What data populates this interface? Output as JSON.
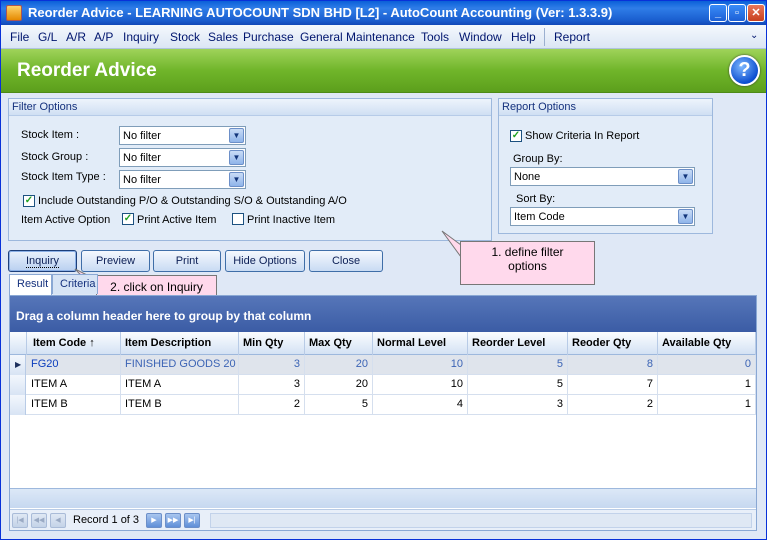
{
  "window": {
    "title": "Reorder Advice - LEARNING AUTOCOUNT SDN BHD [L2] - AutoCount Accounting (Ver: 1.3.3.9)"
  },
  "window_controls": {
    "minimize": "_",
    "restore": "▫",
    "close": "✕"
  },
  "menu": [
    "File",
    "G/L",
    "A/R",
    "A/P",
    "Inquiry",
    "Stock",
    "Sales",
    "Purchase",
    "General Maintenance",
    "Tools",
    "Window",
    "Help",
    "Report"
  ],
  "menu_chevron": "⌄",
  "header": {
    "title": "Reorder Advice",
    "help_glyph": "?"
  },
  "filter": {
    "title": "Filter Options",
    "stock_item_label": "Stock Item :",
    "stock_item_value": "No filter",
    "stock_group_label": "Stock Group :",
    "stock_group_value": "No filter",
    "stock_item_type_label": "Stock Item Type :",
    "stock_item_type_value": "No filter",
    "include_outstanding_label": "Include Outstanding P/O & Outstanding S/O & Outstanding A/O",
    "include_outstanding_checked": true,
    "item_active_label": "Item Active Option",
    "print_active_label": "Print Active Item",
    "print_active_checked": true,
    "print_inactive_label": "Print Inactive Item",
    "print_inactive_checked": false
  },
  "report_options": {
    "title": "Report Options",
    "show_criteria_label": "Show Criteria In Report",
    "show_criteria_checked": true,
    "group_by_label": "Group By:",
    "group_by_value": "None",
    "sort_by_label": "Sort By:",
    "sort_by_value": "Item Code"
  },
  "buttons": {
    "inquiry": "Inquiry",
    "preview": "Preview",
    "print": "Print",
    "hide_options": "Hide Options",
    "close": "Close"
  },
  "callouts": {
    "filter": "1. define filter options",
    "inquiry": "2. click on Inquiry"
  },
  "tabs": [
    "Result",
    "Criteria"
  ],
  "grid": {
    "group_panel_text": "Drag a column header here to group by that column",
    "columns": [
      "Item Code",
      "Item Description",
      "Min Qty",
      "Max Qty",
      "Normal Level",
      "Reorder Level",
      "Reoder Qty",
      "Available Qty"
    ],
    "sort_glyph": "↑",
    "rows": [
      [
        "FG20",
        "FINISHED GOODS 20",
        "3",
        "20",
        "10",
        "5",
        "8",
        "0"
      ],
      [
        "ITEM A",
        "ITEM A",
        "3",
        "20",
        "10",
        "5",
        "7",
        "1"
      ],
      [
        "ITEM B",
        "ITEM B",
        "2",
        "5",
        "4",
        "3",
        "2",
        "1"
      ]
    ],
    "record_text": "Record 1 of 3"
  },
  "colors": {
    "header_green": "#70b52a",
    "titlebar_blue": "#1a5ecf",
    "callout_pink": "#ffd9ec"
  }
}
